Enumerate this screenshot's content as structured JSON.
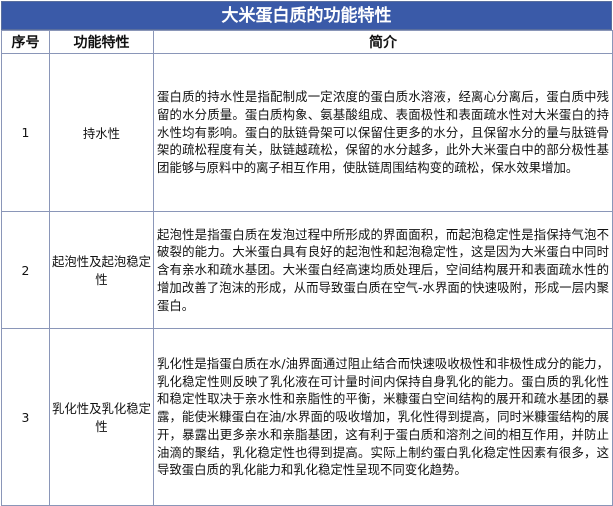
{
  "title": "大米蛋白质的功能特性",
  "headers": [
    "序号",
    "功能特性",
    "简介"
  ],
  "rows": [
    {
      "index": "1",
      "property": "持水性",
      "desc": "蛋白质的持水性是指配制成一定浓度的蛋白质水溶液，经离心分离后，蛋白质中残留的水分质量。蛋白质构象、氨基酸组成、表面极性和表面疏水性对大米蛋白的持水性均有影响。蛋白的肽链骨架可以保留住更多的水分，且保留水分的量与肽链骨架的疏松程度有关，肽链越疏松，保留的水分越多，此外大米蛋白中的部分极性基团能够与原料中的离子相互作用，使肽链周围结构变的疏松，保水效果增加。"
    },
    {
      "index": "2",
      "property": "起泡性及起泡稳定性",
      "desc": "起泡性是指蛋白质在发泡过程中所形成的界面面积，而起泡稳定性是指保持气泡不破裂的能力。大米蛋白具有良好的起泡性和起泡稳定性，这是因为大米蛋白中同时含有亲水和疏水基团。大米蛋白经高速均质处理后，空间结构展开和表面疏水性的增加改善了泡沫的形成，从而导致蛋白质在空气-水界面的快速吸附，形成一层内聚蛋白。"
    },
    {
      "index": "3",
      "property": "乳化性及乳化稳定性",
      "desc": "乳化性是指蛋白质在水/油界面通过阻止结合而快速吸收极性和非极性成分的能力，乳化稳定性则反映了乳化液在可计量时间内保持自身乳化的能力。蛋白质的乳化性和稳定性取决于亲水性和亲脂性的平衡，米糠蛋白空间结构的展开和疏水基团的暴露，能使米糠蛋白在油/水界面的吸收增加，乳化性得到提高，同时米糠蛋结构的展开，暴露出更多亲水和亲脂基团，这有利于蛋白质和溶剂之间的相互作用，并防止油滴的聚结，乳化稳定性也得到提高。实际上制约蛋白乳化稳定性因素有很多，这导致蛋白质的乳化能力和乳化稳定性呈现不同变化趋势。"
    }
  ],
  "colors": {
    "title_bg": "#3a5aa8",
    "title_fg": "#ffffff",
    "border": "#8a96b8"
  }
}
